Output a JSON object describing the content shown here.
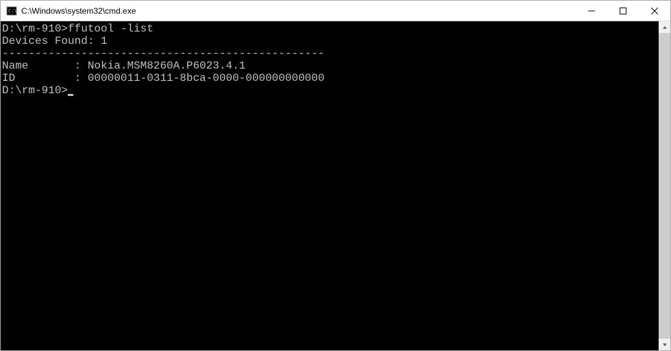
{
  "window": {
    "title": "C:\\Windows\\system32\\cmd.exe"
  },
  "terminal": {
    "line1_prompt": "D:\\rm-910>",
    "line1_command": "ffutool -list",
    "blank1": "",
    "devices_found": "Devices Found: 1",
    "separator": "-------------------------------------------------",
    "name_label": "Name",
    "name_sep": "       : ",
    "name_value": "Nokia.MSM8260A.P6023.4.1",
    "id_label": "ID",
    "id_sep": "         : ",
    "id_value": "00000011-0311-8bca-0000-000000000000",
    "blank2": "",
    "line2_prompt": "D:\\rm-910>"
  }
}
